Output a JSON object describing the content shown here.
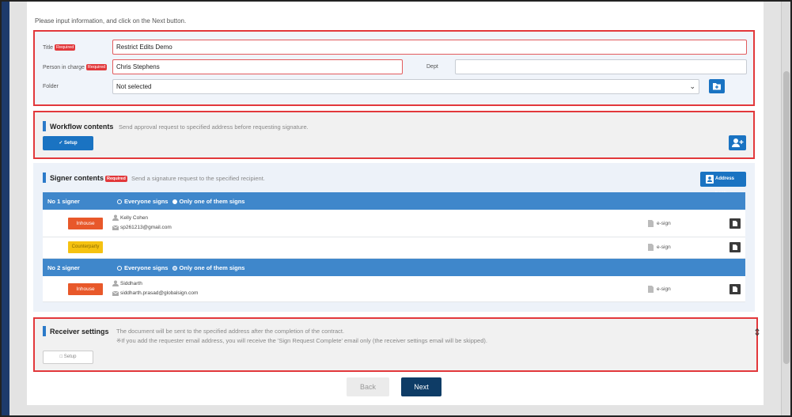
{
  "instruction": "Please input information, and click on the Next button.",
  "required_badge": "Required",
  "basic": {
    "title_label": "Title",
    "title_value": "Restrict Edits Demo",
    "person_label": "Person in charge",
    "person_value": "Chris Stephens",
    "dept_label": "Dept",
    "dept_value": "",
    "folder_label": "Folder",
    "folder_value": "Not selected"
  },
  "workflow": {
    "title": "Workflow contents",
    "description": "Send approval request to specified address before requesting signature.",
    "setup_label": "Setup"
  },
  "signer": {
    "title": "Signer contents",
    "description": "Send a signature request to the specified recipient.",
    "address_book_label": "Address book",
    "option_all": "Everyone signs",
    "option_one": "Only one of them signs",
    "groups": [
      {
        "label": "No 1 signer",
        "rows": [
          {
            "type": "Inhouse",
            "name": "Kelly Cohen",
            "email": "sp261213@gmail.com",
            "method": "e-sign"
          },
          {
            "type": "Counterparty",
            "name": "",
            "email": "",
            "method": "e-sign"
          }
        ]
      },
      {
        "label": "No 2 signer",
        "rows": [
          {
            "type": "Inhouse",
            "name": "Siddharth",
            "email": "siddharth.prasad@globalsign.com",
            "method": "e-sign"
          }
        ]
      }
    ]
  },
  "receiver": {
    "title": "Receiver settings",
    "description": "The document will be sent to the specified address after the completion of the contract.",
    "note": "※If you add the requester email address, you will receive the 'Sign Request Complete' email only (the receiver settings email will be skipped).",
    "setup_label": "Setup"
  },
  "nav": {
    "back_label": "Back",
    "next_label": "Next"
  },
  "colors": {
    "primary": "#1a73c2",
    "signer_header": "#3f87cb",
    "highlight": "#e2383b",
    "next": "#0e3c66",
    "inhouse": "#e8582a",
    "counterparty": "#f5c211"
  }
}
